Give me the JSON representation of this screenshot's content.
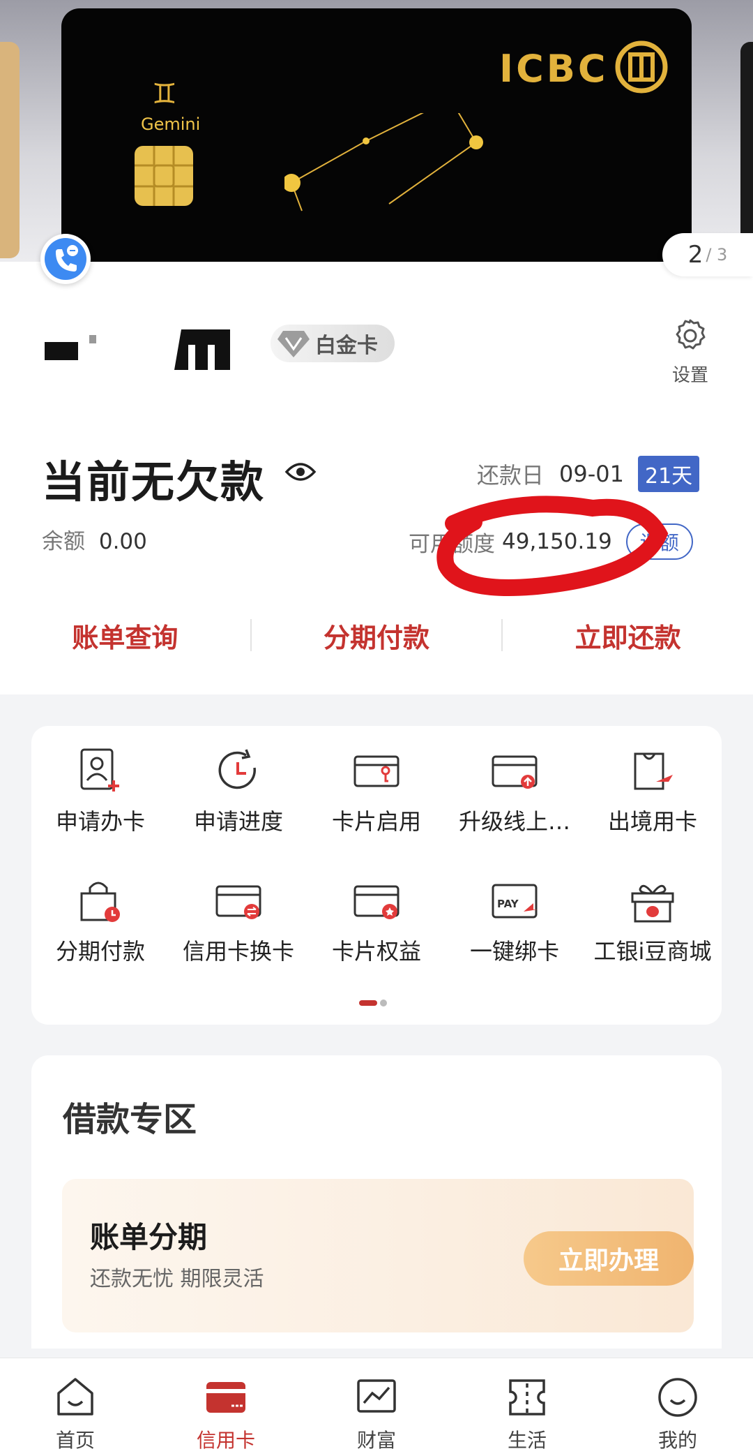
{
  "card_carousel": {
    "bank_logo_text": "ICBC",
    "card_zodiac_name": "Gemini",
    "page_current": "2",
    "page_total": "/ 3"
  },
  "account": {
    "tier_badge": "白金卡",
    "settings_label": "设置",
    "status_title": "当前无欠款",
    "due_label": "还款日",
    "due_date": "09-01",
    "days_left": "21天",
    "balance_label": "余额",
    "balance_value": "0.00",
    "credit_label": "可用额度",
    "credit_value": "49,150.19",
    "adjust_label": "调额"
  },
  "quick_actions": [
    "账单查询",
    "分期付款",
    "立即还款"
  ],
  "services": [
    {
      "label": "申请办卡",
      "icon": "user-card-add-icon"
    },
    {
      "label": "申请进度",
      "icon": "progress-clock-icon"
    },
    {
      "label": "卡片启用",
      "icon": "card-key-icon"
    },
    {
      "label": "升级线上…",
      "icon": "card-upgrade-icon"
    },
    {
      "label": "出境用卡",
      "icon": "bag-plane-icon"
    },
    {
      "label": "分期付款",
      "icon": "bag-clock-icon"
    },
    {
      "label": "信用卡换卡",
      "icon": "card-swap-icon"
    },
    {
      "label": "卡片权益",
      "icon": "card-star-icon"
    },
    {
      "label": "一键绑卡",
      "icon": "pay-card-icon"
    },
    {
      "label": "工银i豆商城",
      "icon": "gift-box-icon"
    }
  ],
  "loan_zone": {
    "title": "借款专区",
    "card_title": "账单分期",
    "card_subtitle": "还款无忧 期限灵活",
    "card_button": "立即办理"
  },
  "tabbar": [
    {
      "label": "首页",
      "icon": "home-icon",
      "active": false
    },
    {
      "label": "信用卡",
      "icon": "credit-card-icon",
      "active": true
    },
    {
      "label": "财富",
      "icon": "wealth-chart-icon",
      "active": false
    },
    {
      "label": "生活",
      "icon": "ticket-icon",
      "active": false
    },
    {
      "label": "我的",
      "icon": "profile-icon",
      "active": false
    }
  ],
  "colors": {
    "accent_red": "#c4332f",
    "accent_blue": "#4267c6",
    "card_gold": "#e2b23c"
  }
}
